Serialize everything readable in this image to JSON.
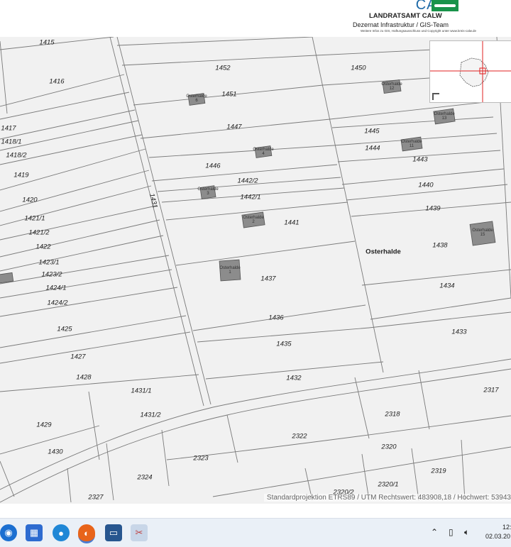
{
  "header": {
    "brand": "CALW",
    "office": "LANDRATSAMT CALW",
    "department": "Dezernat Infrastruktur / GIS-Team",
    "disclaimer": "Weitere Infos zu GIS, Haftungsausschluss und Copyright unter www.kreis-calw.de"
  },
  "map": {
    "street_name": "Osterhalde",
    "projection_text": "Standardprojektion ETRS89 / UTM Rechtswert: 483908,18 / Hochwert: 53943",
    "parcels": [
      {
        "id": "1415"
      },
      {
        "id": "1416"
      },
      {
        "id": "1417"
      },
      {
        "id": "1418/1"
      },
      {
        "id": "1418/2"
      },
      {
        "id": "1419"
      },
      {
        "id": "1420"
      },
      {
        "id": "1421/1"
      },
      {
        "id": "1421/2"
      },
      {
        "id": "1422"
      },
      {
        "id": "1423/1"
      },
      {
        "id": "1423/2"
      },
      {
        "id": "1424/1"
      },
      {
        "id": "1424/2"
      },
      {
        "id": "1425"
      },
      {
        "id": "1427"
      },
      {
        "id": "1428"
      },
      {
        "id": "1429"
      },
      {
        "id": "1430"
      },
      {
        "id": "1431"
      },
      {
        "id": "1431/1"
      },
      {
        "id": "1431/2"
      },
      {
        "id": "1452"
      },
      {
        "id": "1451"
      },
      {
        "id": "1447"
      },
      {
        "id": "1446"
      },
      {
        "id": "1442/2"
      },
      {
        "id": "1442/1"
      },
      {
        "id": "1441"
      },
      {
        "id": "1437"
      },
      {
        "id": "1436"
      },
      {
        "id": "1435"
      },
      {
        "id": "1432"
      },
      {
        "id": "1450"
      },
      {
        "id": "1445"
      },
      {
        "id": "1444"
      },
      {
        "id": "1443"
      },
      {
        "id": "1440"
      },
      {
        "id": "1439"
      },
      {
        "id": "1438"
      },
      {
        "id": "1434"
      },
      {
        "id": "1433"
      },
      {
        "id": "2317"
      },
      {
        "id": "2318"
      },
      {
        "id": "2322"
      },
      {
        "id": "2320"
      },
      {
        "id": "2323"
      },
      {
        "id": "2319"
      },
      {
        "id": "2324"
      },
      {
        "id": "2320/1"
      },
      {
        "id": "2320/2"
      },
      {
        "id": "2327"
      }
    ],
    "houses": [
      {
        "label": "Osterhalde",
        "num": "6"
      },
      {
        "label": "Osterhalde",
        "num": "12"
      },
      {
        "label": "Osterhalde",
        "num": "13"
      },
      {
        "label": "Osterhalde",
        "num": "4"
      },
      {
        "label": "Osterhalde",
        "num": "11"
      },
      {
        "label": "Osterhalde",
        "num": "3"
      },
      {
        "label": "Osterhalde",
        "num": "2"
      },
      {
        "label": "Osterhalde",
        "num": "1"
      },
      {
        "label": "Osterhalde",
        "num": "15"
      }
    ]
  },
  "taskbar": {
    "time": "12:",
    "date": "02.03.20",
    "icons": [
      "windows-start-icon",
      "file-explorer-icon",
      "edge-browser-icon",
      "firefox-icon",
      "app-window-icon",
      "snipping-tool-icon"
    ]
  },
  "colors": {
    "map_background": "#f1f1f1",
    "parcel_line": "#7a7a7a",
    "building_fill": "#8c8c8c",
    "overview_crosshair": "#e02020",
    "brand_blue": "#1e6aa8",
    "brand_green": "#19934a"
  }
}
